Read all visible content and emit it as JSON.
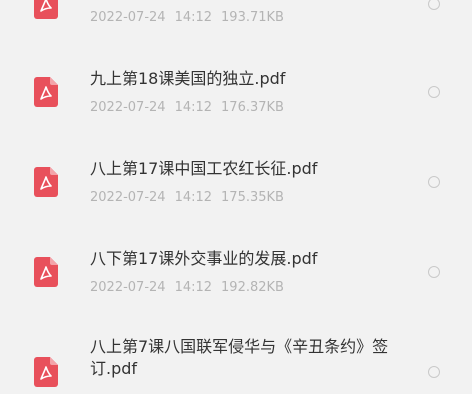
{
  "files": [
    {
      "name": "",
      "date": "2022-07-24",
      "time": "14:12",
      "size": "193.71KB"
    },
    {
      "name": "九上第18课美国的独立.pdf",
      "date": "2022-07-24",
      "time": "14:12",
      "size": "176.37KB"
    },
    {
      "name": "八上第17课中国工农红长征.pdf",
      "date": "2022-07-24",
      "time": "14:12",
      "size": "175.35KB"
    },
    {
      "name": "八下第17课外交事业的发展.pdf",
      "date": "2022-07-24",
      "time": "14:12",
      "size": "192.82KB"
    },
    {
      "name": "八上第7课八国联军侵华与《辛丑条约》签订.pdf",
      "date": "",
      "time": "",
      "size": ""
    }
  ],
  "colors": {
    "pdf_icon": "#e8505b",
    "background": "#f2f2f2",
    "title_text": "#333333",
    "meta_text": "#b4b4b4",
    "radio_border": "#c9c9c9"
  },
  "icons": {
    "file_type": "pdf-icon",
    "select": "radio-unchecked-icon"
  }
}
